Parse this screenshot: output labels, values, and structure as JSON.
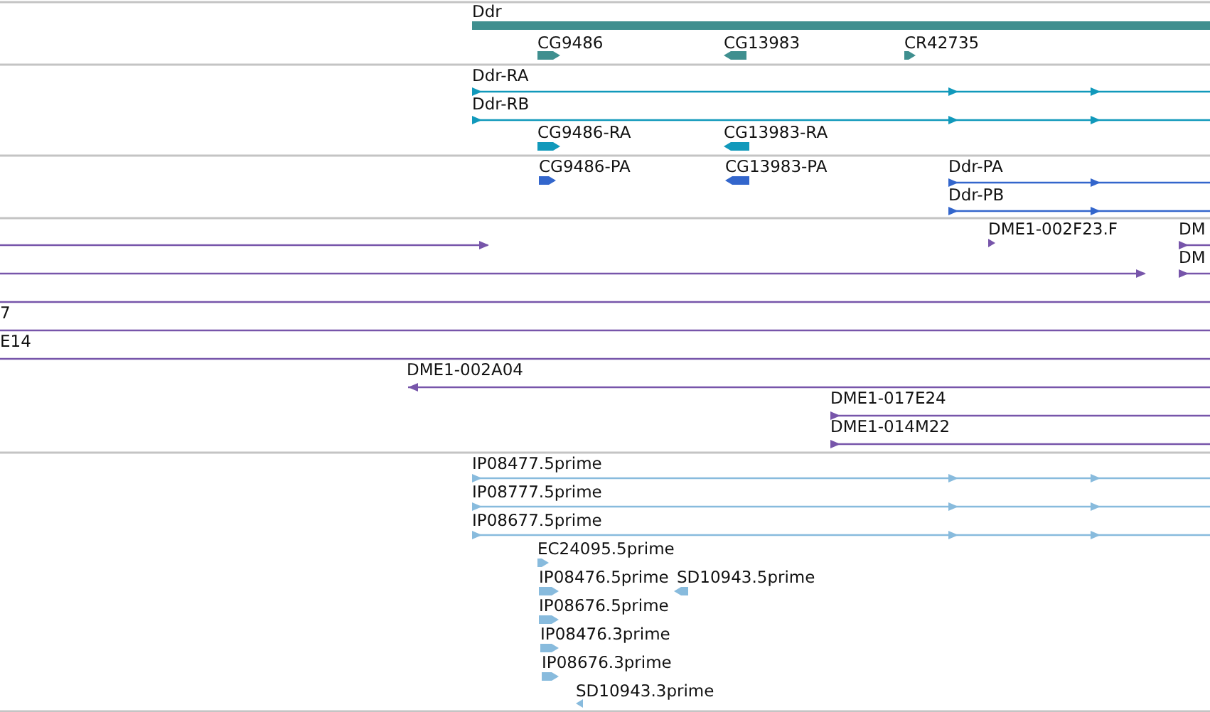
{
  "tracks": [
    {
      "color": "#3f8f8f",
      "features": [
        {
          "kind": "bar",
          "label": "Ddr"
        },
        {
          "kind": "block",
          "label": "CG9486",
          "reverse": false
        },
        {
          "kind": "block",
          "label": "CG13983",
          "reverse": true
        },
        {
          "kind": "block",
          "label": "CR42735",
          "reverse": false
        }
      ]
    },
    {
      "color": "#1199bb",
      "features": [
        {
          "kind": "line",
          "label": "Ddr-RA",
          "reverse": false
        },
        {
          "kind": "line",
          "label": "Ddr-RB",
          "reverse": false
        },
        {
          "kind": "block",
          "label": "CG9486-RA",
          "reverse": false
        },
        {
          "kind": "block",
          "label": "CG13983-RA",
          "reverse": true
        }
      ]
    },
    {
      "color": "#3366cc",
      "features": [
        {
          "kind": "block",
          "label": "CG9486-PA",
          "reverse": false
        },
        {
          "kind": "block",
          "label": "CG13983-PA",
          "reverse": true
        },
        {
          "kind": "line",
          "label": "Ddr-PA",
          "reverse": false
        },
        {
          "kind": "line",
          "label": "Ddr-PB",
          "reverse": false
        }
      ]
    },
    {
      "color": "#7755aa",
      "features": [
        {
          "kind": "line",
          "reverse": false
        },
        {
          "kind": "block",
          "label": "DME1-002F23.F",
          "reverse": false
        },
        {
          "kind": "line",
          "label": "DM",
          "reverse": false
        },
        {
          "kind": "line",
          "reverse": false
        },
        {
          "kind": "line",
          "label": "DM",
          "reverse": false
        },
        {
          "kind": "line"
        },
        {
          "kind": "line",
          "label": "7"
        },
        {
          "kind": "line",
          "label": "E14"
        },
        {
          "kind": "line",
          "label": "DME1-002A04",
          "reverse": true
        },
        {
          "kind": "line",
          "label": "DME1-017E24",
          "reverse": false
        },
        {
          "kind": "line",
          "label": "DME1-014M22",
          "reverse": false
        }
      ]
    },
    {
      "color": "#88bbdd",
      "features": [
        {
          "kind": "line",
          "label": "IP08477.5prime",
          "reverse": false
        },
        {
          "kind": "line",
          "label": "IP08777.5prime",
          "reverse": false
        },
        {
          "kind": "line",
          "label": "IP08677.5prime",
          "reverse": false
        },
        {
          "kind": "block",
          "label": "EC24095.5prime",
          "reverse": false
        },
        {
          "kind": "block",
          "label": "IP08476.5prime",
          "reverse": false
        },
        {
          "kind": "block",
          "label": "SD10943.5prime",
          "reverse": true
        },
        {
          "kind": "block",
          "label": "IP08676.5prime",
          "reverse": false
        },
        {
          "kind": "block",
          "label": "IP08476.3prime",
          "reverse": false
        },
        {
          "kind": "block",
          "label": "IP08676.3prime",
          "reverse": false
        },
        {
          "kind": "block",
          "label": "SD10943.3prime",
          "reverse": true
        }
      ]
    }
  ]
}
